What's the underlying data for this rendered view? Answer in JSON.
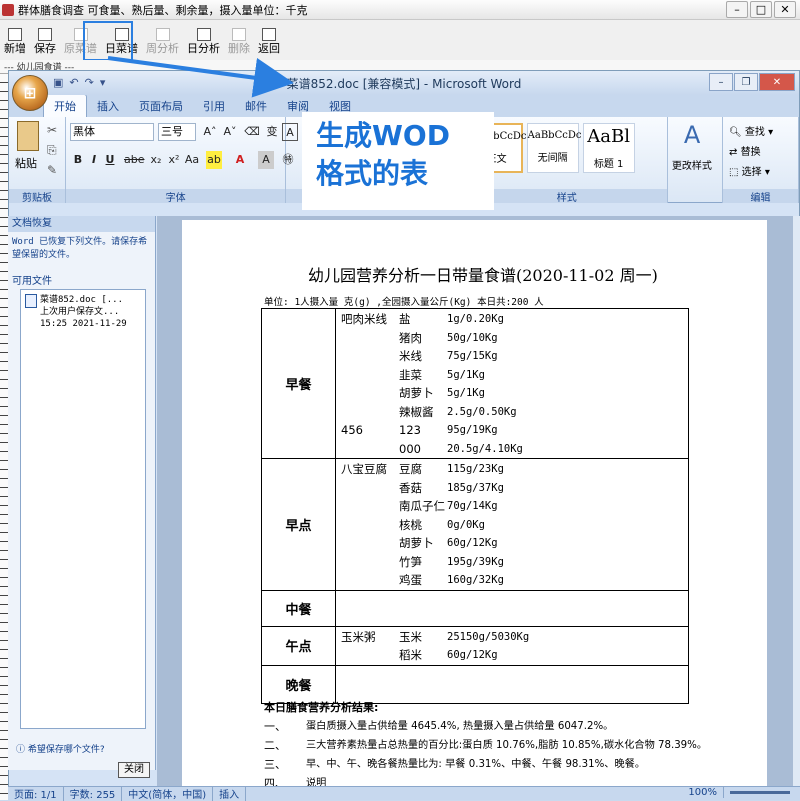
{
  "background_app": {
    "title": "群体膳食调查  可食量、熟后量、剩余量，摄入量单位：千克",
    "toolbar": [
      {
        "label": "新增",
        "disabled": false
      },
      {
        "label": "保存",
        "disabled": false
      },
      {
        "label": "原菜谱",
        "disabled": true
      },
      {
        "label": "日菜谱",
        "disabled": false
      },
      {
        "label": "周分析",
        "disabled": true
      },
      {
        "label": "日分析",
        "disabled": false
      },
      {
        "label": "删除",
        "disabled": true
      },
      {
        "label": "返回",
        "disabled": false
      }
    ],
    "strip_text": "--- 幼儿园食谱  ---"
  },
  "overlay": {
    "line1": "生成WOD",
    "line2": "格式的表"
  },
  "word": {
    "title": "菜谱852.doc [兼容模式] - Microsoft Word",
    "tabs": [
      "开始",
      "插入",
      "页面布局",
      "引用",
      "邮件",
      "审阅",
      "视图"
    ],
    "active_tab": "开始",
    "clipboard": {
      "paste": "粘贴",
      "label": "剪贴板"
    },
    "font": {
      "name": "黑体",
      "size": "三号",
      "label": "字体"
    },
    "styles": {
      "items": [
        {
          "preview": "AaBbCcDc",
          "name": "正文"
        },
        {
          "preview": "AaBbCcDc",
          "name": "无间隔"
        },
        {
          "preview": "AaBl",
          "name": "标题 1"
        }
      ],
      "change": "更改样式",
      "label": "样式"
    },
    "edit": {
      "find": "查找",
      "replace": "替换",
      "select": "选择",
      "label": "编辑"
    },
    "recovery": {
      "header": "文档恢复",
      "message": "Word 已恢复下列文件。请保存希望保留的文件。",
      "available": "可用文件",
      "file": {
        "name": "菜谱852.doc  [...",
        "desc": "上次用户保存文...",
        "time": "15:25 2021-11-29"
      },
      "which": "希望保存哪个文件?",
      "close": "关闭"
    },
    "status": {
      "page": "页面: 1/1",
      "words": "字数: 255",
      "lang": "中文(简体，中国)",
      "mode": "插入",
      "zoom": "100%"
    }
  },
  "document": {
    "title": "幼儿园营养分析一日带量食谱(2020-11-02 周一)",
    "unit_line": "单位: 1人摄入量 克(g)  ,全园摄入量公斤(Kg)        本日共:200 人",
    "meals": [
      {
        "name": "早餐",
        "rows": [
          [
            "吧肉米线",
            "盐",
            "1g/0.20Kg"
          ],
          [
            "",
            "猪肉",
            "50g/10Kg"
          ],
          [
            "",
            "米线",
            "75g/15Kg"
          ],
          [
            "",
            "韭菜",
            "5g/1Kg"
          ],
          [
            "",
            "胡萝卜",
            "5g/1Kg"
          ],
          [
            "",
            "辣椒酱",
            "2.5g/0.50Kg"
          ],
          [
            "456",
            "123",
            "95g/19Kg"
          ],
          [
            "",
            "000",
            "20.5g/4.10Kg"
          ]
        ]
      },
      {
        "name": "早点",
        "rows": [
          [
            "八宝豆腐",
            "豆腐",
            "115g/23Kg"
          ],
          [
            "",
            "香菇",
            "185g/37Kg"
          ],
          [
            "",
            "南瓜子仁",
            "70g/14Kg"
          ],
          [
            "",
            "核桃",
            "0g/0Kg"
          ],
          [
            "",
            "胡萝卜",
            "60g/12Kg"
          ],
          [
            "",
            "竹笋",
            "195g/39Kg"
          ],
          [
            "",
            "鸡蛋",
            "160g/32Kg"
          ]
        ]
      },
      {
        "name": "中餐",
        "rows": []
      },
      {
        "name": "午点",
        "rows": [
          [
            "玉米粥",
            "玉米",
            "25150g/5030Kg"
          ],
          [
            "",
            "稻米",
            "60g/12Kg"
          ]
        ]
      },
      {
        "name": "晚餐",
        "rows": []
      }
    ],
    "summary": {
      "heading": "本日膳食营养分析结果:",
      "items": [
        {
          "num": "一、",
          "text": "蛋白质摄入量占供给量 4645.4%, 热量摄入量占供给量 6047.2%。"
        },
        {
          "num": "二、",
          "text": "三大营养素热量占总热量的百分比:蛋白质 10.76%,脂肪 10.85%,碳水化合物 78.39%。"
        },
        {
          "num": "三、",
          "text": "早、中、午、晚各餐热量比为: 早餐 0.31%、中餐、午餐 98.31%、晚餐。"
        },
        {
          "num": "四、",
          "text": "说明"
        }
      ]
    }
  }
}
